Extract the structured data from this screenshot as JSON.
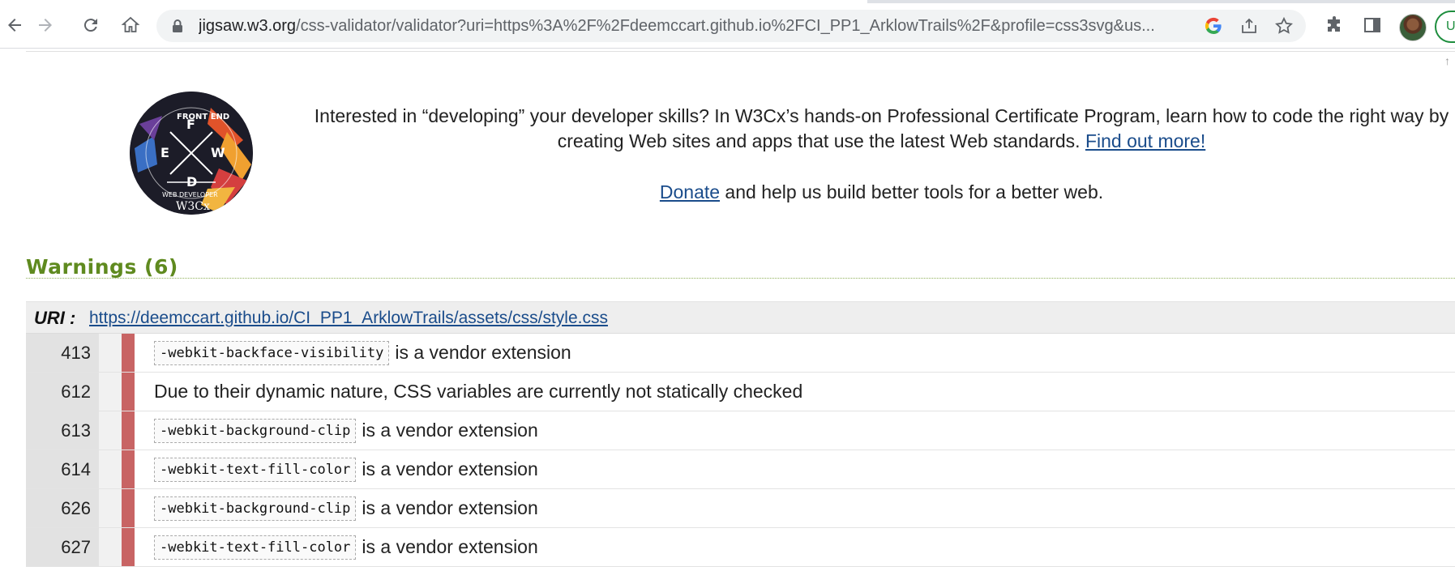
{
  "browser": {
    "url_host": "jigsaw.w3.org",
    "url_path": "/css-validator/validator?uri=https%3A%2F%2Fdeemccart.github.io%2FCI_PP1_ArklowTrails%2F&profile=css3svg&us...",
    "profile_initial": "U",
    "icons": [
      "back-icon",
      "forward-icon",
      "reload-icon",
      "home-icon",
      "lock-icon",
      "google-icon",
      "share-icon",
      "star-icon",
      "extensions-icon",
      "side-panel-icon"
    ]
  },
  "promo": {
    "text": "Interested in “developing” your developer skills? In W3Cx’s hands-on Professional Certificate Program, learn how to code the right way by creating Web sites and apps that use the latest Web standards.",
    "link_label": "Find out more!",
    "donate_label": "Donate",
    "donate_text": " and help us build better tools for a better web."
  },
  "badge": {
    "top_text": "FRONT END",
    "letters": [
      "F",
      "E",
      "W",
      "D"
    ],
    "bottom_text": "WEB DEVELOPER",
    "brand": "W3Cx"
  },
  "warnings": {
    "title": "Warnings (6)",
    "uri_label": "URI :",
    "uri": "https://deemccart.github.io/CI_PP1_ArklowTrails/assets/css/style.css",
    "rows": [
      {
        "line": "413",
        "code": "-webkit-backface-visibility",
        "text": "is a vendor extension"
      },
      {
        "line": "612",
        "code": "",
        "text": "Due to their dynamic nature, CSS variables are currently not statically checked"
      },
      {
        "line": "613",
        "code": "-webkit-background-clip",
        "text": "is a vendor extension"
      },
      {
        "line": "614",
        "code": "-webkit-text-fill-color",
        "text": "is a vendor extension"
      },
      {
        "line": "626",
        "code": "-webkit-background-clip",
        "text": "is a vendor extension"
      },
      {
        "line": "627",
        "code": "-webkit-text-fill-color",
        "text": "is a vendor extension"
      }
    ]
  },
  "colors": {
    "warning_bar": "#c86464",
    "warnings_title": "#5f8a1f",
    "link": "#1a4c8b"
  }
}
